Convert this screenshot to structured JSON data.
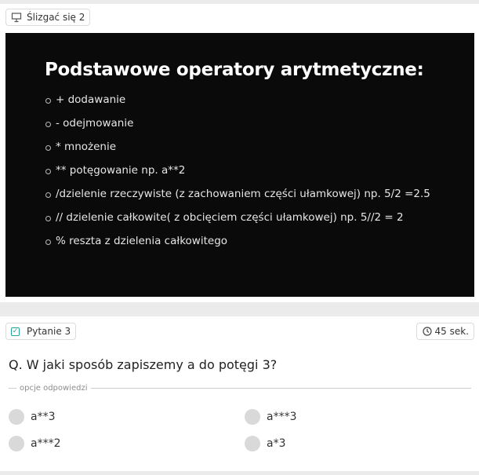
{
  "slide": {
    "chip_label": "Ślizgać się 2",
    "title": "Podstawowe operatory arytmetyczne:",
    "items": [
      "+ dodawanie",
      "- odejmowanie",
      "* mnożenie",
      "** potęgowanie np. a**2",
      "/dzielenie rzeczywiste (z zachowaniem części ułamkowej) np. 5/2 =2.5",
      "// dzielenie całkowite( z obcięciem części ułamkowej) np. 5//2 = 2",
      "% reszta z dzielenia całkowitego"
    ]
  },
  "question": {
    "chip_label": "Pytanie 3",
    "timer": "45 sek.",
    "text": "Q. W jaki sposób zapiszemy a do potęgi 3?",
    "options_heading": "opcje odpowiedzi",
    "options": [
      "a**3",
      "a***3",
      "a***2",
      "a*3"
    ],
    "accent_color": "#26a69a"
  }
}
